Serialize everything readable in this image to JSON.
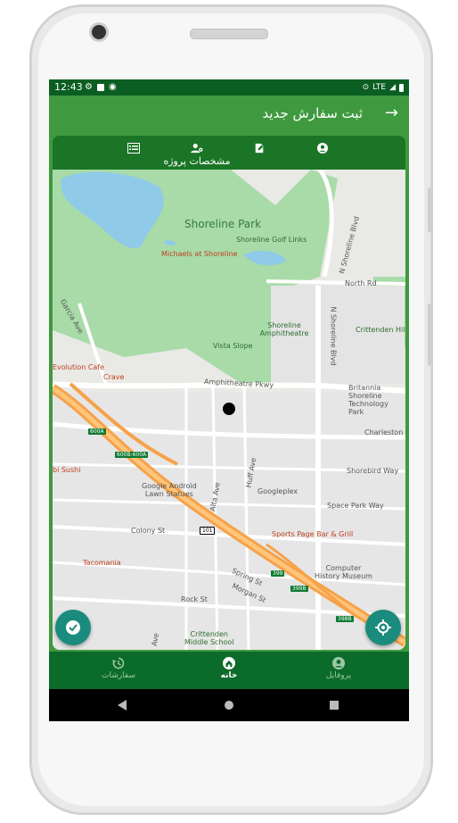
{
  "status": {
    "time": "12:43",
    "network": "LTE"
  },
  "appbar": {
    "title": "ثبت سفارش جدید",
    "back_icon": "arrow-right-icon"
  },
  "tabs": [
    {
      "icon": "user-icon"
    },
    {
      "icon": "edit-icon"
    },
    {
      "icon": "user-gear-icon",
      "label": "مشخصات پروژه"
    },
    {
      "icon": "list-icon"
    }
  ],
  "map": {
    "labels": {
      "park": "Shoreline Park",
      "golf": "Shoreline Golf Links",
      "michaels": "Michaels at Shoreline",
      "north_rd": "North Rd",
      "shoreline_blvd_n": "N Shoreline Blvd",
      "shoreline_blvd": "N Shoreline Blvd",
      "amphitheatre": "Shoreline\nAmphitheatre",
      "vista": "Vista Slope",
      "crittenden_hill": "Crittenden Hill",
      "garcia": "Garcia Ave",
      "evolution": "Evolution Cafe",
      "crave": "Crave",
      "amph_pkwy": "Amphitheatre Pkwy",
      "britannia": "Britannia Shoreline\nTechnology Park",
      "charleston": "Charleston Rd",
      "shorebird": "Shorebird Way",
      "sushi": "bi Sushi",
      "google_android": "Google Android\nLawn Statues",
      "huff": "Huff Ave",
      "alta": "Alta Ave",
      "googleplex": "Googleplex",
      "space_park": "Space Park Way",
      "colony": "Colony St",
      "sports_page": "Sports Page Bar & Grill",
      "tacomania": "Tacomania",
      "computer_museum": "Computer\nHistory Museum",
      "spring": "Spring St",
      "morgan": "Morgan St",
      "rock": "Rock St",
      "crittenden_school": "Crittenden\nMiddle School",
      "ave": "Ave"
    },
    "shields": [
      "600A",
      "600B-600A",
      "101",
      "399",
      "399B",
      "398B"
    ]
  },
  "fab_confirm": {
    "icon": "check-circle-icon"
  },
  "fab_locate": {
    "icon": "crosshair-icon"
  },
  "bottomnav": [
    {
      "icon": "history-icon",
      "label": "سفارشات"
    },
    {
      "icon": "home-icon",
      "label": "خانه",
      "active": true
    },
    {
      "icon": "account-circle-icon",
      "label": "پروفایل"
    }
  ]
}
